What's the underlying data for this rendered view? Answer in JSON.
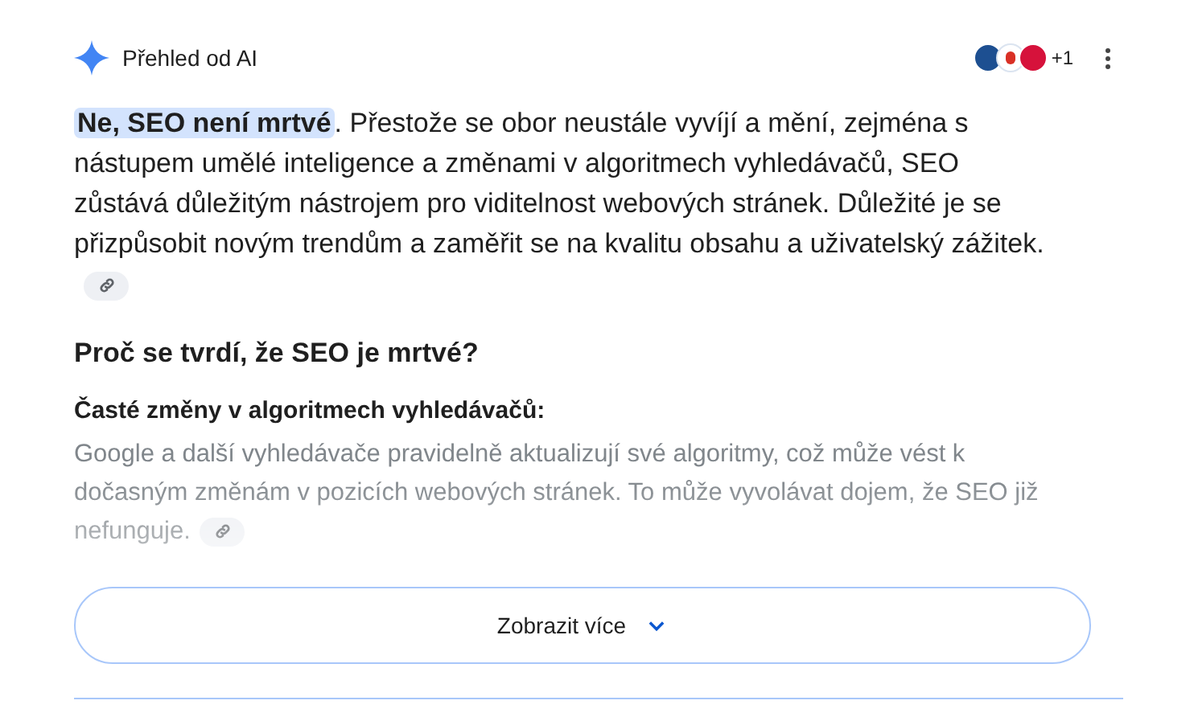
{
  "header": {
    "title": "Přehled od AI",
    "sources_more": "+1"
  },
  "answer": {
    "highlight": "Ne, SEO není mrtvé",
    "text": ". Přestože se obor neustále vyvíjí a mění, zejména s nástupem umělé inteligence a změnami v algoritmech vyhledávačů, SEO zůstává důležitým nástrojem pro viditelnost webových stránek. Důležité je se přizpůsobit novým trendům a zaměřit se na kvalitu obsahu a uživatelský zážitek."
  },
  "section": {
    "heading": "Proč se tvrdí, že SEO je mrtvé?",
    "subheading": "Časté změny v algoritmech vyhledávačů:",
    "text": "Google a další vyhledávače pravidelně aktualizují své algoritmy, což může vést k dočasným změnám v pozicích webových stránek. To může vyvolávat dojem, že SEO již nefunguje."
  },
  "show_more": {
    "label": "Zobrazit více"
  }
}
